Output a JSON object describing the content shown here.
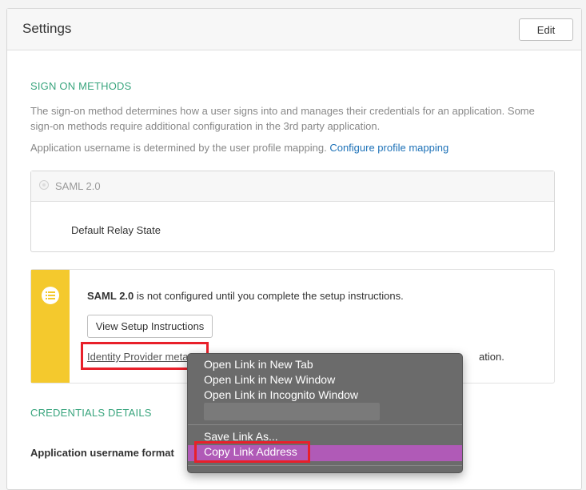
{
  "header": {
    "title": "Settings",
    "edit_label": "Edit"
  },
  "sign_on": {
    "title": "SIGN ON METHODS",
    "description": "The sign-on method determines how a user signs into and manages their credentials for an application. Some sign-on methods require additional configuration in the 3rd party application.",
    "username_text": "Application username is determined by the user profile mapping.",
    "profile_link": "Configure profile mapping"
  },
  "saml_option": {
    "label": "SAML 2.0",
    "relay_state_label": "Default Relay State"
  },
  "notice": {
    "bold": "SAML 2.0",
    "text": " is not configured until you complete the setup instructions.",
    "button_label": "View Setup Instructions",
    "idp_link": "Identity Provider meta",
    "idp_tail": "ation."
  },
  "credentials": {
    "title": "CREDENTIALS DETAILS",
    "username_format_label": "Application username format"
  },
  "context_menu": {
    "items": [
      "Open Link in New Tab",
      "Open Link in New Window",
      "Open Link in Incognito Window",
      "Save Link As...",
      "Copy Link Address"
    ],
    "highlight_color": "#b05ab7"
  },
  "colors": {
    "accent_green": "#3aa57e",
    "link_blue": "#1e72b8",
    "notice_yellow": "#f4c92d",
    "annotation_red": "#e8202a"
  }
}
